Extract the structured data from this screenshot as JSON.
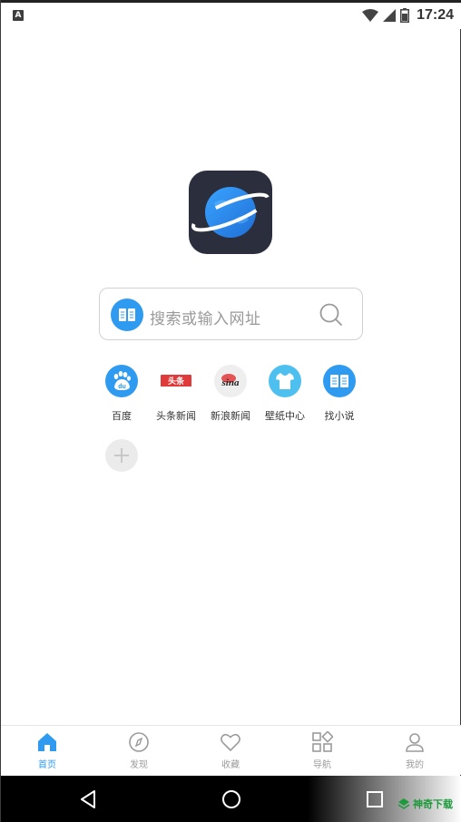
{
  "status_bar": {
    "notification": "A",
    "time": "17:24"
  },
  "search": {
    "placeholder": "搜索或输入网址"
  },
  "shortcuts": [
    {
      "label": "百度",
      "icon": "baidu-paw-icon"
    },
    {
      "label": "头条新闻",
      "icon": "toutiao-logo-icon",
      "logo_text": "头条"
    },
    {
      "label": "新浪新闻",
      "icon": "sina-logo-icon",
      "logo_text": "sina"
    },
    {
      "label": "壁纸中心",
      "icon": "tshirt-icon"
    },
    {
      "label": "找小说",
      "icon": "book-icon"
    }
  ],
  "add_shortcut": {
    "icon": "plus-icon"
  },
  "bottom_nav": [
    {
      "label": "首页",
      "icon": "home-icon",
      "active": true
    },
    {
      "label": "发现",
      "icon": "compass-icon",
      "active": false
    },
    {
      "label": "收藏",
      "icon": "heart-icon",
      "active": false
    },
    {
      "label": "导航",
      "icon": "grid-icon",
      "active": false
    },
    {
      "label": "我的",
      "icon": "person-icon",
      "active": false
    }
  ],
  "watermark": "神奇下载",
  "colors": {
    "accent": "#2e9bf0",
    "logo_bg": "#2b2f3d",
    "inactive": "#9b9b9b"
  }
}
